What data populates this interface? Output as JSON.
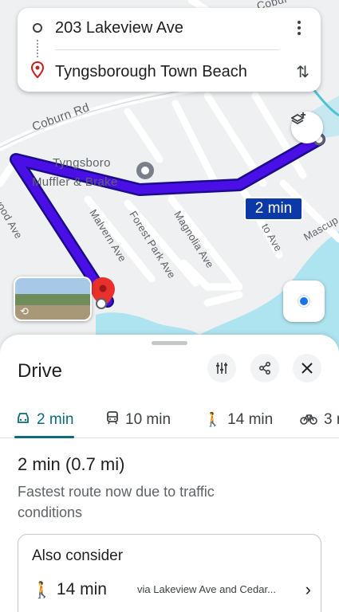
{
  "directions": {
    "origin": "203 Lakeview Ave",
    "destination": "Tyngsborough Town Beach"
  },
  "map": {
    "poi_name_line1": "Tyngsboro",
    "poi_name_line2": "Muffler & Brake",
    "streets": {
      "coburn": "Coburn Rd",
      "coburn_top": "Cobur",
      "malvern": "Malvern Ave",
      "forest_park": "Forest Park Ave",
      "magnolia": "Magnolia Ave",
      "wood": "wood Ave",
      "plato": "to Ave",
      "mascup": "Mascup"
    },
    "route_time_badge": "2 min",
    "route_color": "#4a0fe6"
  },
  "sheet": {
    "title": "Drive",
    "tabs": [
      {
        "icon": "car-icon",
        "label": "2 min",
        "active": true
      },
      {
        "icon": "transit-icon",
        "label": "10 min",
        "active": false
      },
      {
        "icon": "walk-icon",
        "label": "14 min",
        "active": false
      },
      {
        "icon": "bike-icon",
        "label": "3 r",
        "active": false
      }
    ],
    "summary": "2 min (0.7 mi)",
    "description": "Fastest route now due to traffic conditions",
    "also_consider": {
      "title": "Also consider",
      "mode_icon": "walk-icon",
      "time": "14 min",
      "via": "via Lakeview Ave and Cedar..."
    }
  },
  "colors": {
    "accent": "#0b6b7a",
    "badge": "#0b3aa8",
    "water": "#aee3f0"
  }
}
